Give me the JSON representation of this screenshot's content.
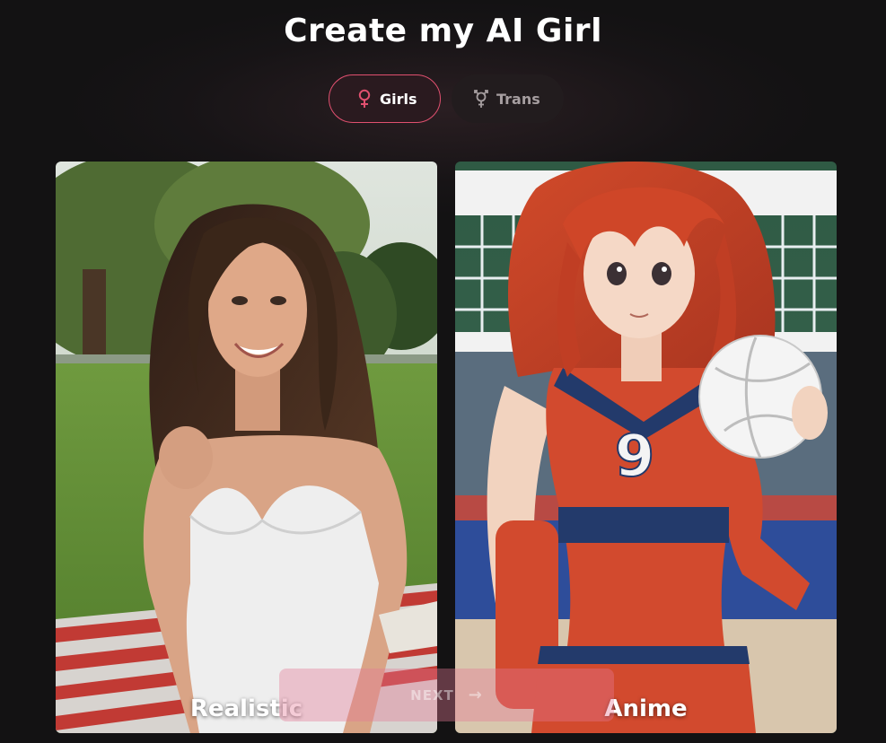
{
  "header": {
    "title": "Create my AI Girl"
  },
  "filters": {
    "girls": {
      "label": "Girls",
      "icon": "female-icon",
      "selected": true
    },
    "trans": {
      "label": "Trans",
      "icon": "transgender-icon",
      "selected": false
    }
  },
  "styles": [
    {
      "label": "Realistic"
    },
    {
      "label": "Anime"
    }
  ],
  "next_button": {
    "label": "NEXT",
    "icon": "arrow-right-icon",
    "enabled": false
  },
  "colors": {
    "accent": "#e0506f",
    "background": "#141213"
  }
}
